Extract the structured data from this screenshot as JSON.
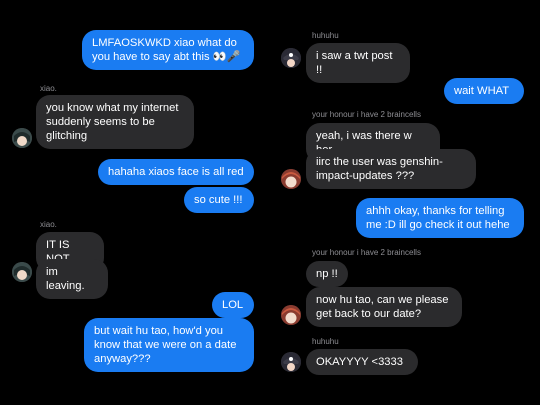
{
  "left": {
    "msg1": "LMFAOSKWKD xiao what do you have to say abt this 👀🎤",
    "sender1": "xiao.",
    "msg2": "you know what my internet suddenly seems to be glitching",
    "msg3": "hahaha xiaos face is all red",
    "msg4": "so cute !!!",
    "sender2": "xiao.",
    "msg5": "IT IS NOT",
    "msg6": "im leaving.",
    "msg7": "LOL",
    "msg8": "but wait hu tao, how'd you know that we were on a date anyway???"
  },
  "right": {
    "sender1": "huhuhu",
    "msg1": "i saw a twt post !!",
    "msg2": "wait WHAT",
    "sender2": "your honour i have 2 braincells",
    "msg3": "yeah, i was there w her",
    "msg4": "iirc the user was genshin-impact-updates ???",
    "msg5": "ahhh okay, thanks for telling me :D ill go check it out hehe",
    "sender3": "your honour i have 2 braincells",
    "msg6": "np !!",
    "msg7": "now hu tao, can we please get back to our date?",
    "sender4": "huhuhu",
    "msg8": "OKAYYYY <3333"
  },
  "colors": {
    "outgoing": "#1a7cf2",
    "incoming": "#2b2b2d",
    "background": "#000000",
    "sender": "#8e8e93"
  }
}
